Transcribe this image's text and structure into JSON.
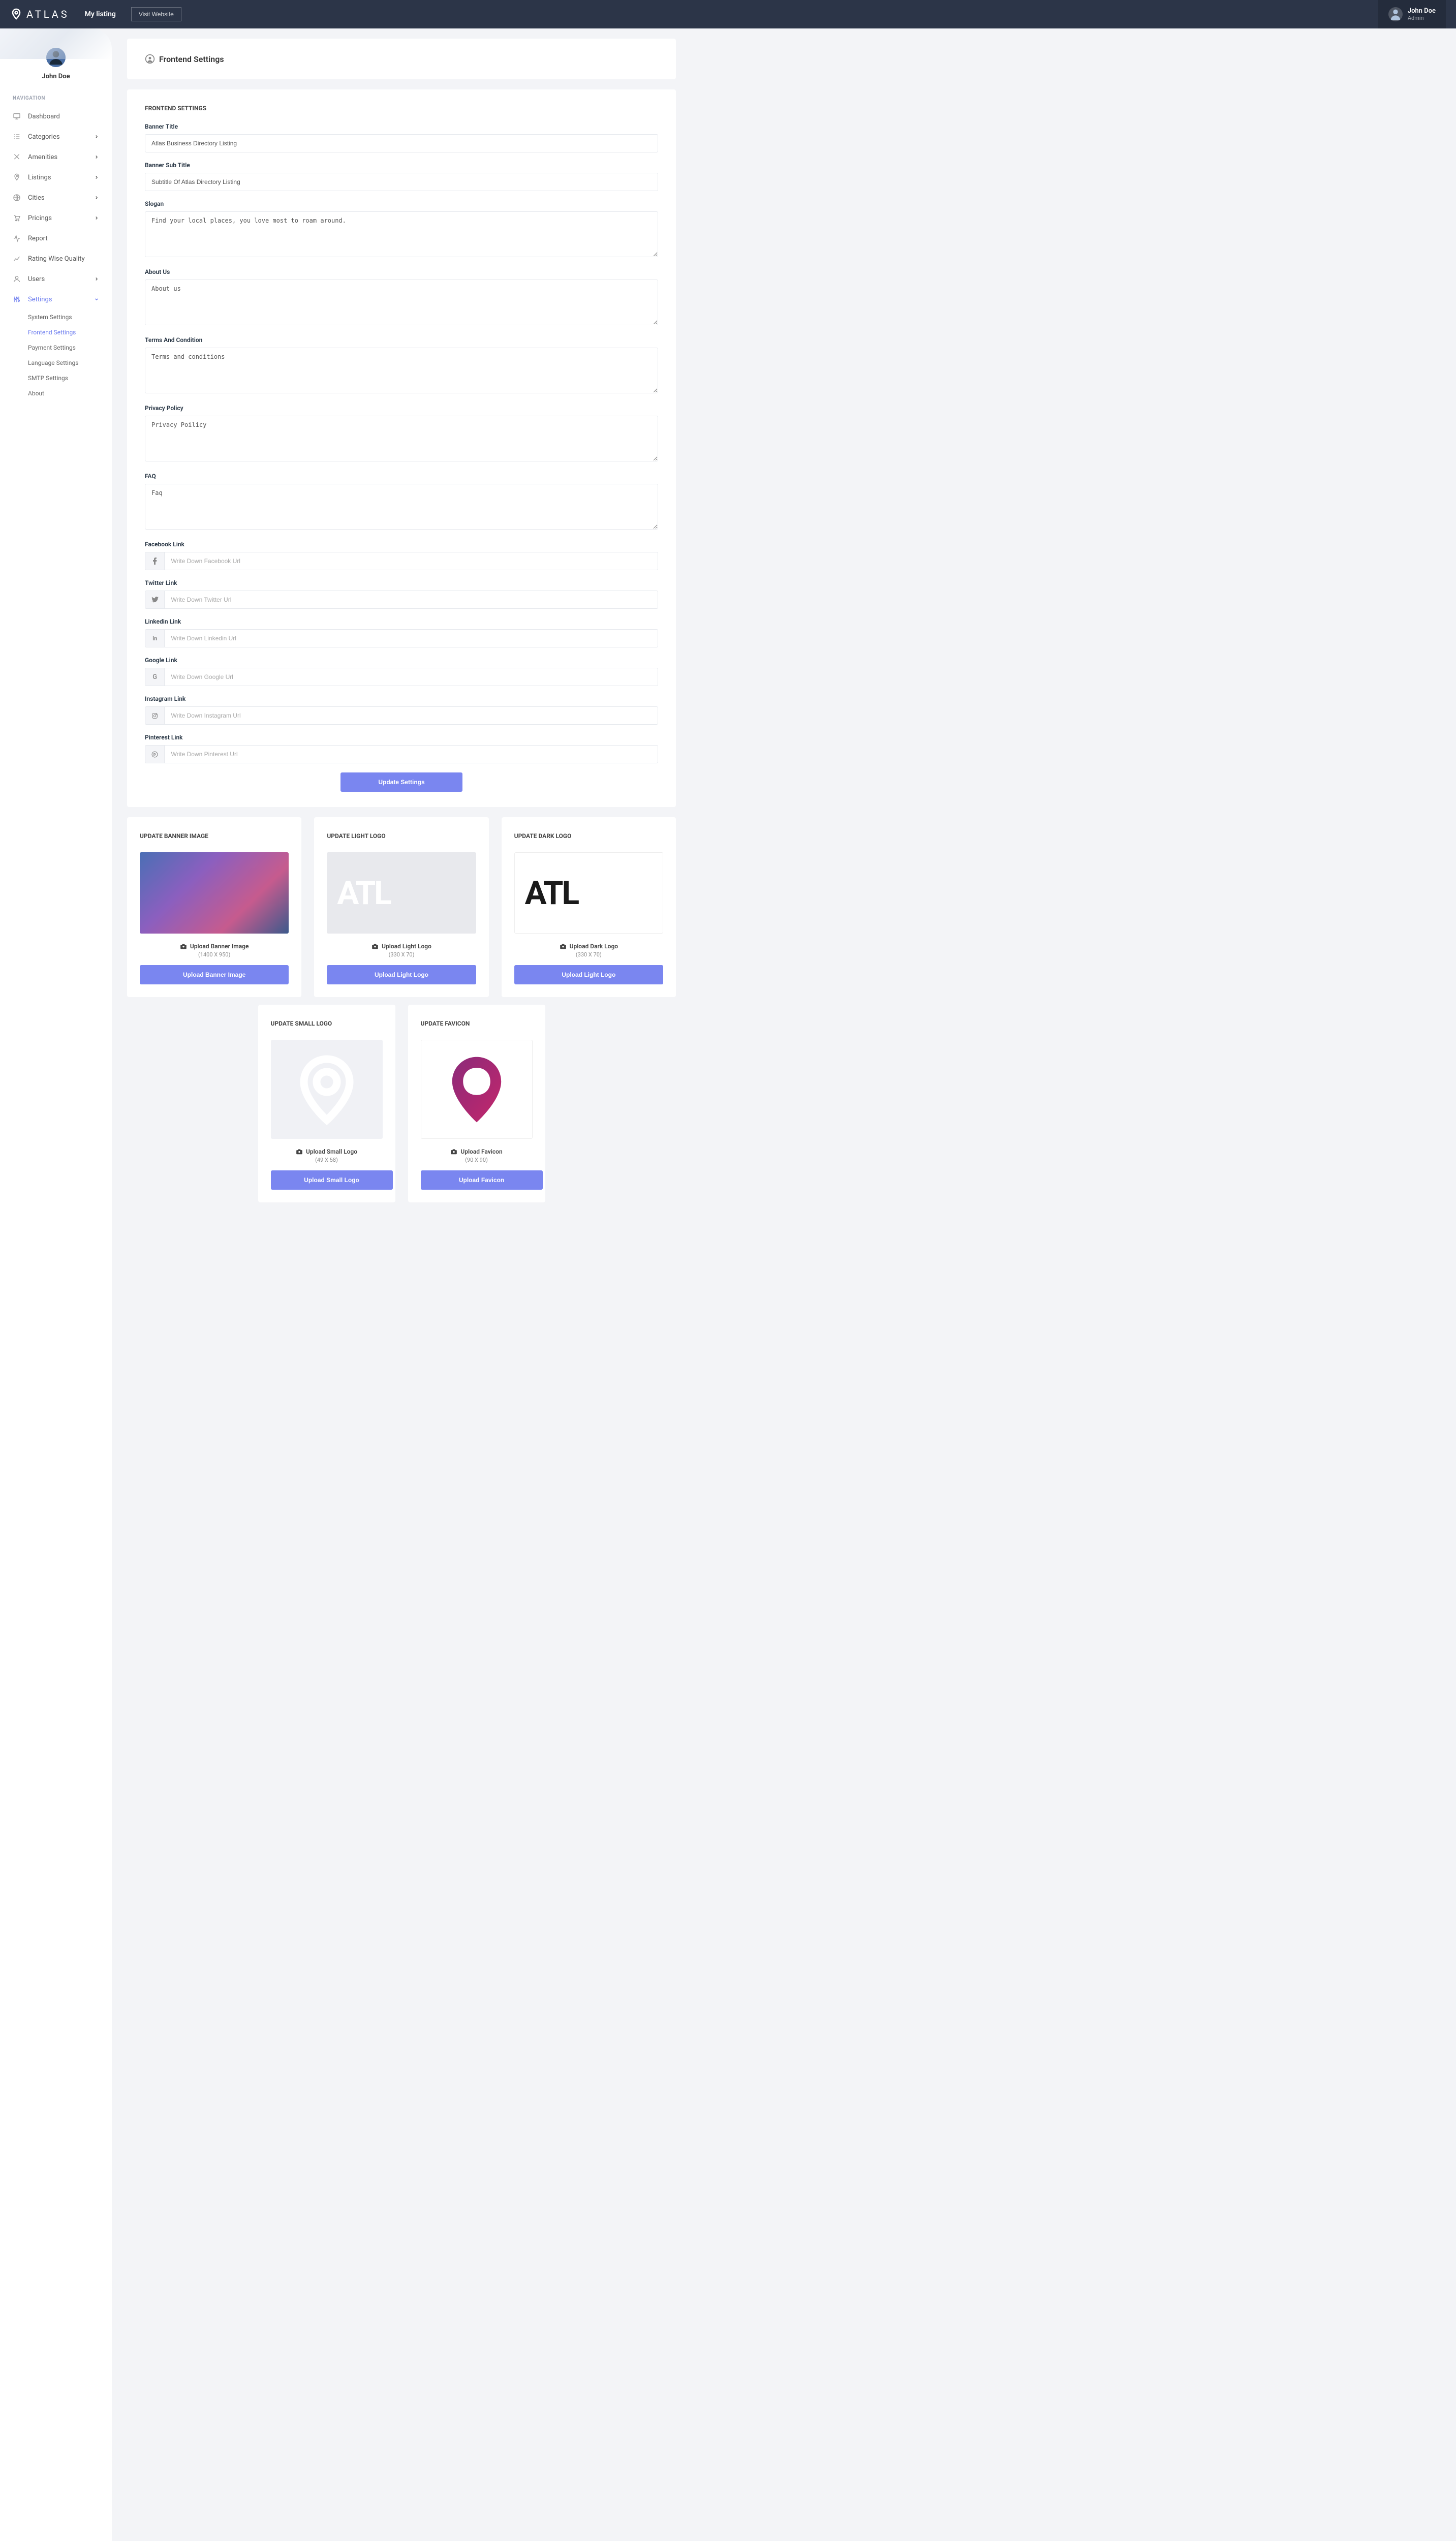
{
  "header": {
    "logo_text": "ATLAS",
    "my_listing": "My listing",
    "visit_btn": "Visit Website",
    "user_name": "John Doe",
    "user_role": "Admin"
  },
  "sidebar": {
    "profile_name": "John Doe",
    "nav_label": "NAVIGATION",
    "items": [
      {
        "label": "Dashboard"
      },
      {
        "label": "Categories"
      },
      {
        "label": "Amenities"
      },
      {
        "label": "Listings"
      },
      {
        "label": "Cities"
      },
      {
        "label": "Pricings"
      },
      {
        "label": "Report"
      },
      {
        "label": "Rating Wise Quality"
      },
      {
        "label": "Users"
      },
      {
        "label": "Settings"
      }
    ],
    "subitems": [
      {
        "label": "System Settings"
      },
      {
        "label": "Frontend Settings"
      },
      {
        "label": "Payment Settings"
      },
      {
        "label": "Language Settings"
      },
      {
        "label": "SMTP Settings"
      },
      {
        "label": "About"
      }
    ]
  },
  "page_title": "Frontend Settings",
  "section_header": "FRONTEND SETTINGS",
  "fields": {
    "banner_title_label": "Banner Title",
    "banner_title_value": "Atlas Business Directory Listing",
    "banner_sub_label": "Banner Sub Title",
    "banner_sub_value": "Subtitle Of Atlas Directory Listing",
    "slogan_label": "Slogan",
    "slogan_value": "Find your local places, you love most to roam around.",
    "about_label": "About Us",
    "about_value": "About us",
    "terms_label": "Terms And Condition",
    "terms_value": "Terms and conditions",
    "privacy_label": "Privacy Policy",
    "privacy_value": "Privacy Poilicy",
    "faq_label": "FAQ",
    "faq_value": "Faq",
    "facebook_label": "Facebook Link",
    "facebook_placeholder": "Write Down Facebook Url",
    "twitter_label": "Twitter Link",
    "twitter_placeholder": "Write Down Twitter Url",
    "linkedin_label": "Linkedin Link",
    "linkedin_placeholder": "Write Down Linkedin Url",
    "google_label": "Google Link",
    "google_placeholder": "Write Down Google Url",
    "instagram_label": "Instagram Link",
    "instagram_placeholder": "Write Down Instagram Url",
    "pinterest_label": "Pinterest Link",
    "pinterest_placeholder": "Write Down Pinterest Url",
    "update_btn": "Update Settings"
  },
  "cards": {
    "banner": {
      "title": "UPDATE BANNER IMAGE",
      "upload_label": "Upload Banner Image",
      "dims": "(1400 X 950)",
      "btn": "Upload Banner Image"
    },
    "light": {
      "title": "UPDATE LIGHT LOGO",
      "upload_label": "Upload Light Logo",
      "dims": "(330 X 70)",
      "btn": "Upload Light Logo",
      "preview": "ATL"
    },
    "dark": {
      "title": "UPDATE DARK LOGO",
      "upload_label": "Upload Dark Logo",
      "dims": "(330 X 70)",
      "btn": "Upload Light Logo",
      "preview": "ATL"
    },
    "small": {
      "title": "UPDATE SMALL LOGO",
      "upload_label": "Upload Small Logo",
      "dims": "(49 X 58)",
      "btn": "Upload Small Logo"
    },
    "favicon": {
      "title": "UPDATE FAVICON",
      "upload_label": "Upload Favicon",
      "dims": "(90 X 90)",
      "btn": "Upload Favicon"
    }
  }
}
